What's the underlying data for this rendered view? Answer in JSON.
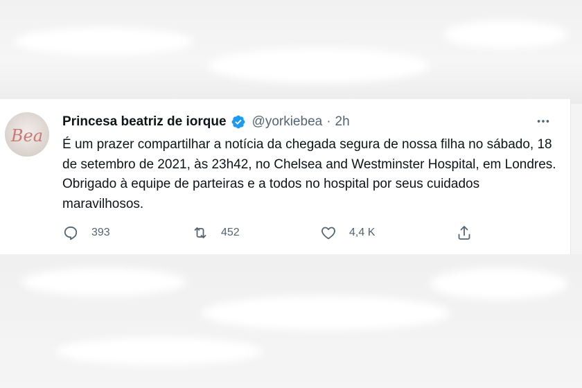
{
  "tweet": {
    "author": {
      "name": "Princesa beatriz de iorque",
      "handle": "@yorkiebea",
      "avatar_text": "Bea",
      "verified_icon": "verified-badge-icon",
      "verified_color": "#1d9bf0"
    },
    "separator": "·",
    "timestamp": "2h",
    "more_icon": "more-options-icon",
    "text": "É um prazer compartilhar a notícia da chegada segura de nossa filha no sábado, 18 de setembro de 2021, às 23h42, no Chelsea and Westminster Hospital, em Londres. Obrigado à equipe de parteiras e a todos no hospital por seus cuidados maravilhosos.",
    "actions": {
      "reply": {
        "icon": "reply-icon",
        "count": "393"
      },
      "retweet": {
        "icon": "retweet-icon",
        "count": "452"
      },
      "like": {
        "icon": "heart-icon",
        "count": "4,4 K"
      },
      "share": {
        "icon": "share-icon"
      }
    }
  },
  "colors": {
    "text_primary": "#0f1419",
    "text_secondary": "#536471",
    "background": "#ffffff"
  }
}
